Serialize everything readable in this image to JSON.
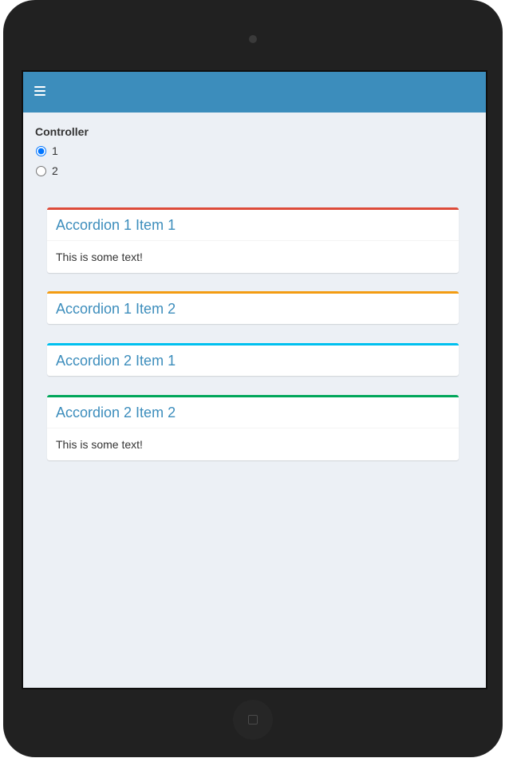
{
  "controller": {
    "label": "Controller",
    "options": [
      {
        "label": "1",
        "checked": true
      },
      {
        "label": "2",
        "checked": false
      }
    ]
  },
  "accordions": [
    {
      "title": "Accordion 1 Item 1",
      "body": "This is some text!",
      "color": "#dd4b39",
      "expanded": true
    },
    {
      "title": "Accordion 1 Item 2",
      "body": "",
      "color": "#f39c12",
      "expanded": false
    },
    {
      "title": "Accordion 2 Item 1",
      "body": "",
      "color": "#00c0ef",
      "expanded": false
    },
    {
      "title": "Accordion 2 Item 2",
      "body": "This is some text!",
      "color": "#00a65a",
      "expanded": true
    }
  ],
  "colors": {
    "navbar": "#3c8dbc",
    "background": "#ecf0f5",
    "device": "#212121"
  },
  "icons": {
    "menu": "hamburger-icon",
    "home": "home-button-icon"
  }
}
